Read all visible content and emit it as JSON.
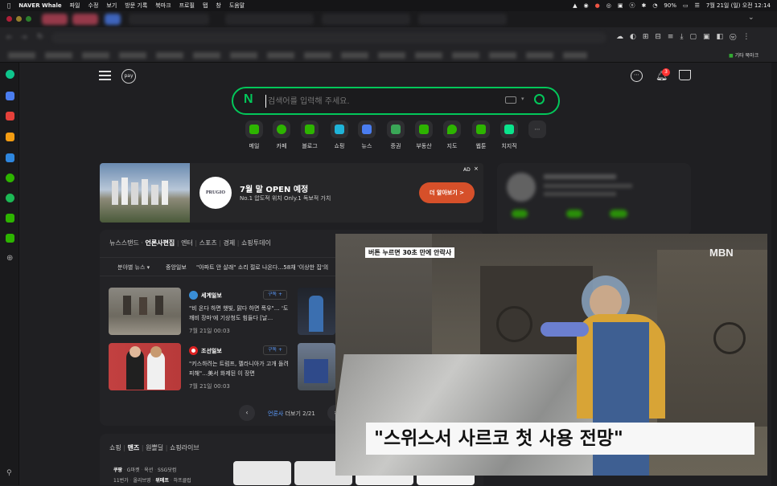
{
  "menubar": {
    "app": "NAVER Whale",
    "menus": [
      "파일",
      "수정",
      "보기",
      "방문 기록",
      "북마크",
      "프로필",
      "탭",
      "창",
      "도움말"
    ],
    "battery": "90%",
    "datetime": "7월 21일 (일) 오전 12:14"
  },
  "bookmarks": {
    "other": "기타 북마크"
  },
  "search": {
    "placeholder": "검색어를 입력해 주세요.",
    "logo": "N"
  },
  "header": {
    "pay_label": "pay",
    "notification_count": "3"
  },
  "services": [
    {
      "label": "메일",
      "color": "#2db400"
    },
    {
      "label": "카페",
      "color": "#2db400"
    },
    {
      "label": "블로그",
      "color": "#2db400"
    },
    {
      "label": "쇼핑",
      "color": "#1fb3d8"
    },
    {
      "label": "뉴스",
      "color": "#4a7df0"
    },
    {
      "label": "증권",
      "color": "#3aa757"
    },
    {
      "label": "부동산",
      "color": "#2db400"
    },
    {
      "label": "지도",
      "color": "#2db400"
    },
    {
      "label": "웹툰",
      "color": "#2db400"
    },
    {
      "label": "치지직",
      "color": "#0ae38c"
    }
  ],
  "ad": {
    "brand": "PRUGIO",
    "title": "7월 말 OPEN 예정",
    "subtitle": "No.1 압도적 위치 Only.1 독보적 가치",
    "cta": "더 알아보기 >",
    "ad_label": "AD"
  },
  "news": {
    "tabs": [
      "뉴스스탠드",
      "언론사편집",
      "엔터",
      "스포츠",
      "경제",
      "쇼핑투데이"
    ],
    "filter": "분야별 뉴스",
    "ticker_source": "중앙일보",
    "ticker_text": "\"아파트 안 살래\" 소리 절로 나온다…58채 '이상한 집'의",
    "items": [
      {
        "source": "세계일보",
        "subscribe": "구독 +",
        "text": "\"비 온다 하면 햇빛, 맑다 하면 폭우\"… '도깨비 장마'에 기상청도 힘들다 [날…",
        "time": "7월 21일 00:03"
      },
      {
        "source": "조선일보",
        "subscribe": "구독 +",
        "text": "\"키스하려는 트럼프, 멜라니아가 고개 돌려 피해\"…美서 화제된 이 장면",
        "time": "7월 21일 00:03"
      }
    ],
    "pager_label": "언론사",
    "pager_more": "더보기",
    "pager": "2/21"
  },
  "shopping": {
    "tabs": [
      "쇼핑",
      "맨즈",
      "원쁠딜",
      "쇼핑라이브"
    ],
    "cats_row1": [
      "쿠팡",
      "G마켓",
      "옥션",
      "SSG닷컴"
    ],
    "cats_row2": [
      "11번가",
      "올리브영",
      "위메프",
      "하프클럽"
    ]
  },
  "video": {
    "caption_top": "버튼 누르면 30초 만에 안락사",
    "channel": "MBN",
    "subtitle": "\"스위스서 사르코 첫 사용 전망\""
  }
}
